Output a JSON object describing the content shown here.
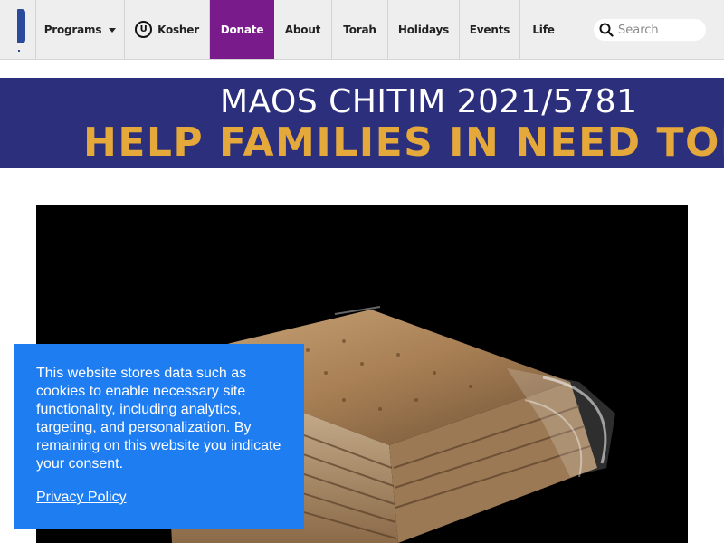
{
  "nav": {
    "logo_icon": "site-logo",
    "items": [
      {
        "label": "Programs",
        "has_dropdown": true
      },
      {
        "label": "Kosher",
        "icon": "ou-kosher-symbol",
        "icon_text": "U"
      },
      {
        "label": "Donate",
        "highlight_color": "#7a1b8b"
      },
      {
        "label": "About"
      },
      {
        "label": "Torah"
      },
      {
        "label": "Holidays"
      },
      {
        "label": "Events"
      },
      {
        "label": "Life"
      }
    ],
    "search": {
      "placeholder": "Search",
      "value": ""
    }
  },
  "banner": {
    "line1": "MAOS CHITIM 2021/5781",
    "line2": "HELP FAMILIES IN NEED TODAY",
    "bg_color": "#2c2f7b",
    "accent_color": "#e4a93a"
  },
  "hero": {
    "image": "matzah-package-photo"
  },
  "cookie_notice": {
    "message": "This website stores data such as cookies to enable necessary site functionality, including analytics, targeting, and personalization. By remaining on this website you indicate your consent.",
    "link_label": "Privacy Policy",
    "bg_color": "#1f7df2"
  }
}
